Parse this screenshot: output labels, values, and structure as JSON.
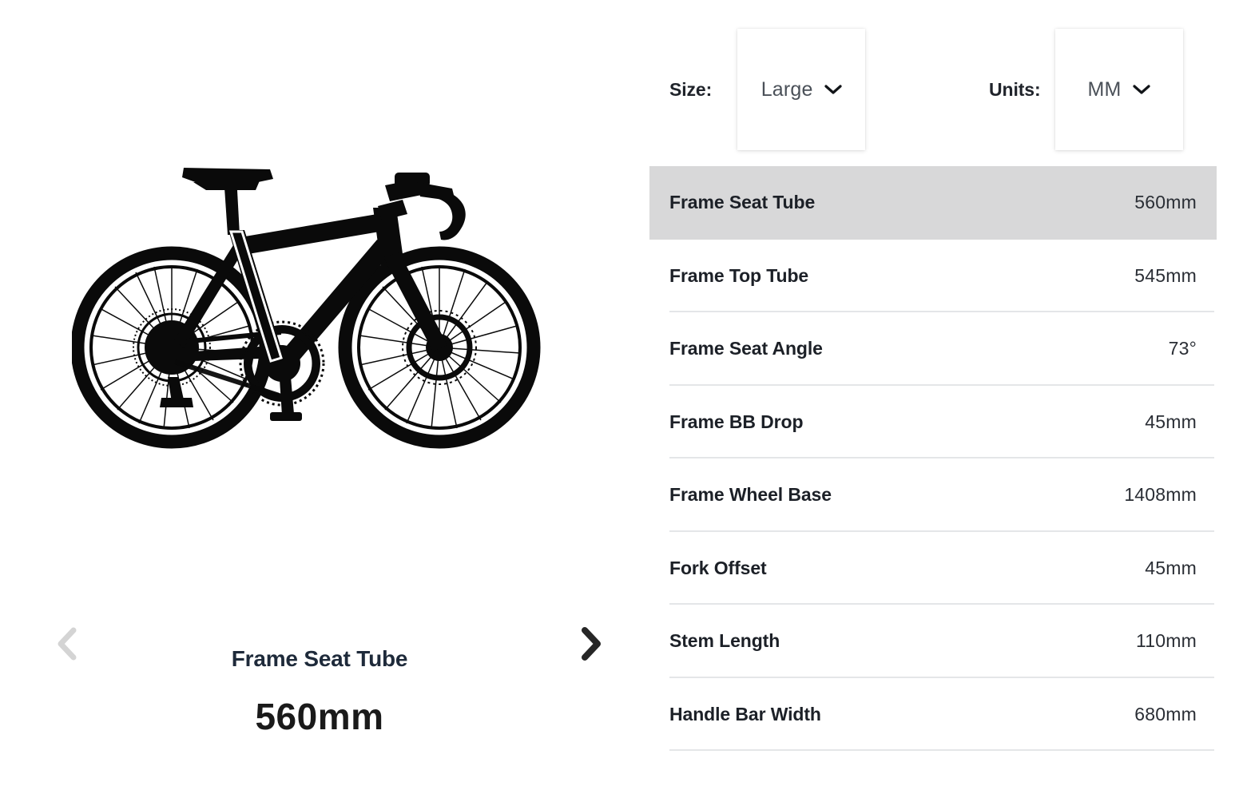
{
  "controls": {
    "size": {
      "label": "Size:",
      "value": "Large",
      "chevron_icon": "chevron-down-icon"
    },
    "units": {
      "label": "Units:",
      "value": "MM",
      "chevron_icon": "chevron-down-icon"
    }
  },
  "viewer": {
    "image_alt": "bicycle-silhouette",
    "caption_title": "Frame Seat Tube",
    "caption_value": "560mm",
    "prev_icon": "chevron-left-icon",
    "next_icon": "chevron-right-icon",
    "prev_enabled": "false",
    "next_enabled": "true"
  },
  "spec_table": {
    "selected_index": 0,
    "rows": [
      {
        "label": "Frame Seat Tube",
        "value": "560mm"
      },
      {
        "label": "Frame Top Tube",
        "value": "545mm"
      },
      {
        "label": "Frame Seat Angle",
        "value": "73°"
      },
      {
        "label": "Frame BB Drop",
        "value": "45mm"
      },
      {
        "label": "Frame Wheel Base",
        "value": "1408mm"
      },
      {
        "label": "Fork Offset",
        "value": "45mm"
      },
      {
        "label": "Stem Length",
        "value": "110mm"
      },
      {
        "label": "Handle Bar Width",
        "value": "680mm"
      }
    ]
  },
  "colors": {
    "highlight_row": "#d8d8d9",
    "divider": "#e4e6e8",
    "label_text": "#1c2027",
    "value_text": "#2a2e35",
    "caption_title": "#1e2a3a",
    "caption_value": "#1a1a1a",
    "chevron_disabled": "#d4d4d4",
    "chevron_active": "#262626",
    "select_value_text": "#4a5058"
  }
}
